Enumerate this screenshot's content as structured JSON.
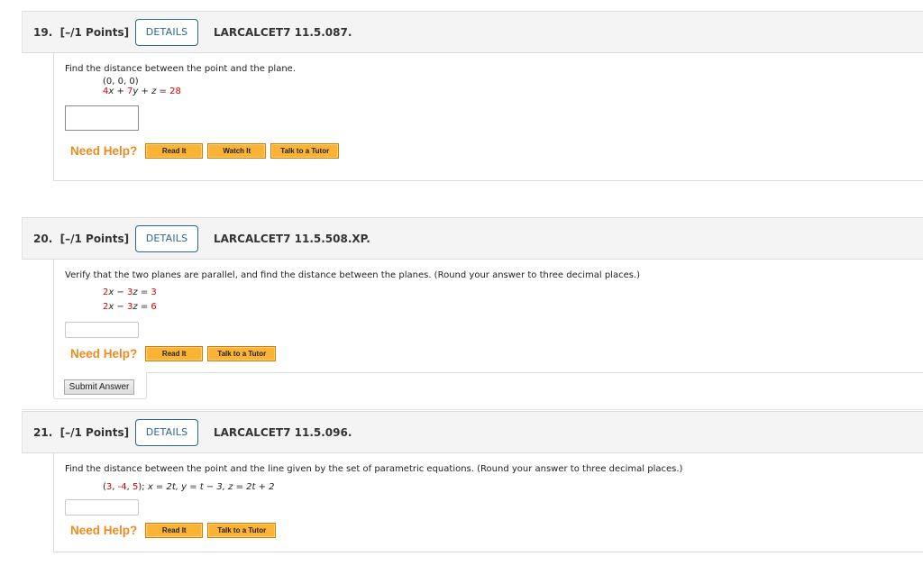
{
  "questions": [
    {
      "number": "19.",
      "points": "[–/1 Points]",
      "details_label": "DETAILS",
      "code": "LARCALCET7 11.5.087.",
      "prompt": "Find the distance between the point and the plane.",
      "point": "(0, 0, 0)",
      "equation": {
        "a": "4",
        "b": "7",
        "rhs": "28"
      },
      "answer_value": "",
      "need_help": "Need Help?",
      "help_buttons": [
        "Read It",
        "Watch It",
        "Talk to a Tutor"
      ]
    },
    {
      "number": "20.",
      "points": "[–/1 Points]",
      "details_label": "DETAILS",
      "code": "LARCALCET7 11.5.508.XP.",
      "prompt": "Verify that the two planes are parallel, and find the distance between the planes. (Round your answer to three decimal places.)",
      "planes": [
        {
          "a": "2",
          "c": "3",
          "rhs": "3"
        },
        {
          "a": "2",
          "c": "3",
          "rhs": "6"
        }
      ],
      "answer_value": "",
      "need_help": "Need Help?",
      "help_buttons": [
        "Read It",
        "Talk to a Tutor"
      ],
      "submit_label": "Submit Answer"
    },
    {
      "number": "21.",
      "points": "[–/1 Points]",
      "details_label": "DETAILS",
      "code": "LARCALCET7 11.5.096.",
      "prompt": "Find the distance between the point and the line given by the set of parametric equations. (Round your answer to three decimal places.)",
      "point": {
        "x": "3",
        "y": "-4",
        "z": "5"
      },
      "parametric": "x = 2t, y = t − 3, z = 2t + 2",
      "answer_value": "",
      "need_help": "Need Help?",
      "help_buttons": [
        "Read It",
        "Talk to a Tutor"
      ]
    }
  ],
  "colors": {
    "accent_blue": "#2c6792",
    "help_orange": "#ee8a1f",
    "button_orange": "#fbb336",
    "math_red": "#e00000"
  }
}
